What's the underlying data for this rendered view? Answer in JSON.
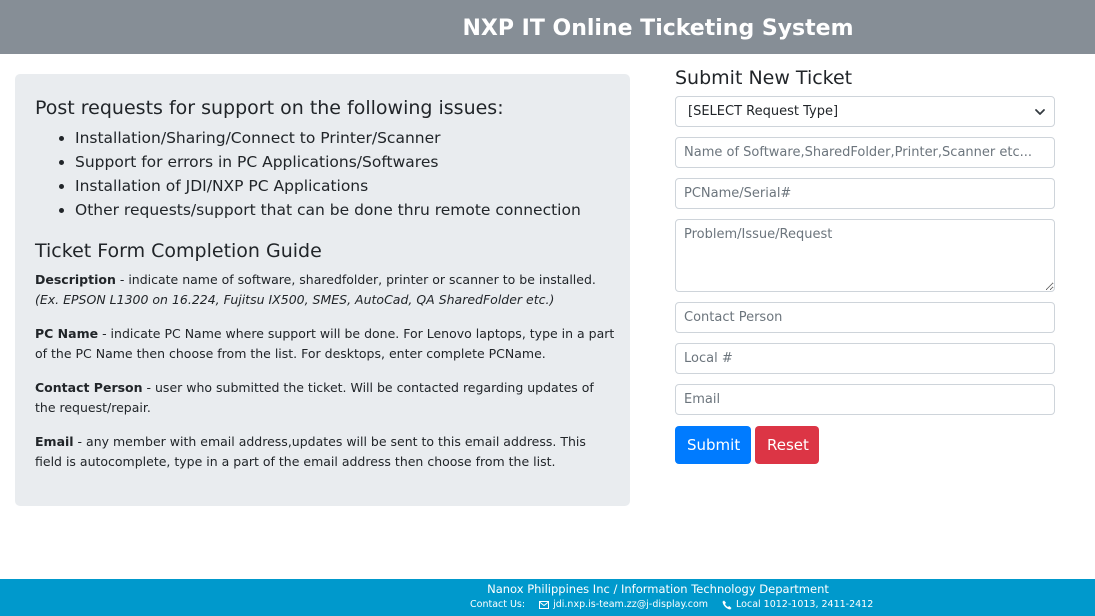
{
  "header": {
    "title": "NXP IT Online Ticketing System"
  },
  "info": {
    "heading": "Post requests for support on the following issues:",
    "issues": [
      "Installation/Sharing/Connect to Printer/Scanner",
      "Support for errors in PC Applications/Softwares",
      "Installation of JDI/NXP PC Applications",
      "Other requests/support that can be done thru remote connection"
    ],
    "guide_heading": "Ticket Form Completion Guide",
    "guide": {
      "description": {
        "term": "Description",
        "text": " - indicate name of software, sharedfolder, printer or scanner to be installed. ",
        "example": "(Ex. EPSON L1300 on 16.224, Fujitsu IX500, SMES, AutoCad, QA SharedFolder etc.)"
      },
      "pc_name": {
        "term": "PC Name",
        "text": " - indicate PC Name where support will be done. For Lenovo laptops, type in a part of the PC Name then choose from the list. For desktops, enter complete PCName."
      },
      "contact_person": {
        "term": "Contact Person",
        "text": " - user who submitted the ticket. Will be contacted regarding updates of the request/repair."
      },
      "email": {
        "term": "Email",
        "text": " - any member with email address,updates will be sent to this email address. This field is autocomplete, type in a part of the email address then choose from the list."
      }
    }
  },
  "form": {
    "title": "Submit New Ticket",
    "request_type": {
      "selected": "[SELECT Request Type]"
    },
    "description_placeholder": "Name of Software,SharedFolder,Printer,Scanner etc...",
    "pcname_placeholder": "PCName/Serial#",
    "problem_placeholder": "Problem/Issue/Request",
    "contact_placeholder": "Contact Person",
    "local_placeholder": "Local #",
    "email_placeholder": "Email",
    "submit_label": "Submit",
    "reset_label": "Reset"
  },
  "footer": {
    "line1": "Nanox Philippines Inc / Information Technology Department",
    "contact_label": "Contact Us:",
    "email": "jdi.nxp.is-team.zz@j-display.com",
    "phone": "Local 1012-1013, 2411-2412",
    "email_icon": "envelope-icon",
    "phone_icon": "phone-icon"
  }
}
